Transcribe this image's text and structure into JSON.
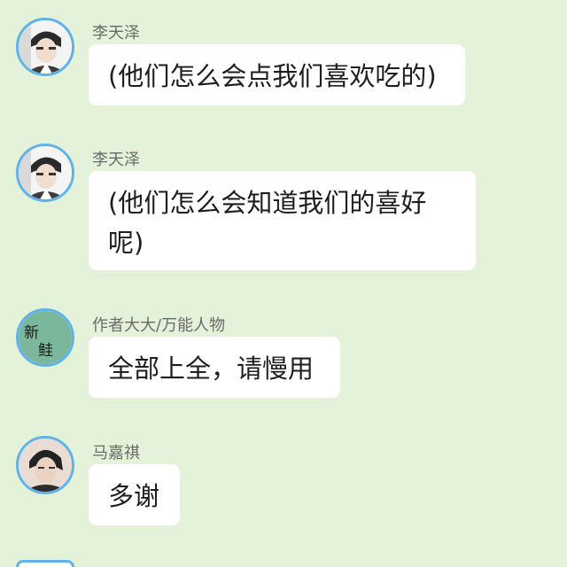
{
  "messages": [
    {
      "sender": "李天泽",
      "text": "(他们怎么会点我们喜欢吃的)",
      "avatar_icon": "boy-selfie-avatar-icon"
    },
    {
      "sender": "李天泽",
      "text": "(他们怎么会知道我们的喜好呢)",
      "avatar_icon": "boy-selfie-avatar-icon"
    },
    {
      "sender": "作者大大/万能人物",
      "text": "全部上全，请慢用",
      "avatar_icon": "handwritten-characters-avatar-icon",
      "avatar_text": "新鲑"
    },
    {
      "sender": "马嘉祺",
      "text": "多谢",
      "avatar_icon": "boy-portrait-avatar-icon"
    }
  ],
  "colors": {
    "background": "#e3f2d9",
    "bubble": "#ffffff",
    "avatar_border": "#5fb3e8",
    "sender_text": "#6b6b6b",
    "message_text": "#1e1e1e"
  }
}
